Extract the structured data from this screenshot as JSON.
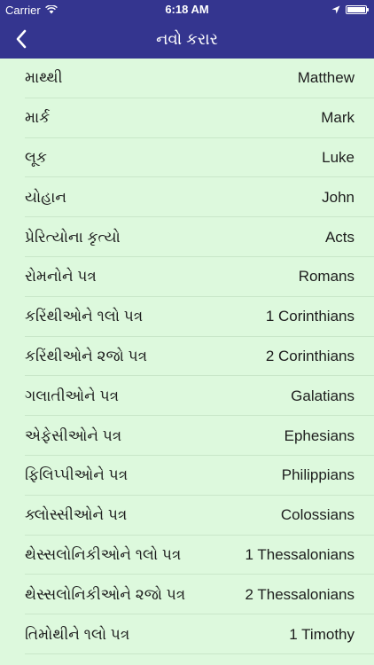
{
  "status_bar": {
    "carrier": "Carrier",
    "time": "6:18 AM"
  },
  "nav": {
    "title": "નવો કરાર",
    "back_icon": "chevron-left-icon"
  },
  "colors": {
    "nav_background": "#34358f",
    "list_background": "#ddf9dd",
    "separator": "#c9e7c9",
    "text": "#1d1d1d"
  },
  "books": [
    {
      "gu": "માથ્થી",
      "en": "Matthew"
    },
    {
      "gu": "માર્ક",
      "en": "Mark"
    },
    {
      "gu": "લૂક",
      "en": "Luke"
    },
    {
      "gu": "યોહાન",
      "en": "John"
    },
    {
      "gu": "પ્રેરિત્યોના કૃત્યો",
      "en": "Acts"
    },
    {
      "gu": "રોમનોને પત્ર",
      "en": "Romans"
    },
    {
      "gu": "કરિંથીઓને ૧લો પત્ર",
      "en": "1 Corinthians"
    },
    {
      "gu": "કરિંથીઓને ૨જો પત્ર",
      "en": "2 Corinthians"
    },
    {
      "gu": "ગલાતીઓને પત્ર",
      "en": "Galatians"
    },
    {
      "gu": "એફેસીઓને પત્ર",
      "en": "Ephesians"
    },
    {
      "gu": "ફિલિપ્પીઓને પત્ર",
      "en": "Philippians"
    },
    {
      "gu": "ક્લોસ્સીઓને પત્ર",
      "en": "Colossians"
    },
    {
      "gu": "થેસ્સલોનિકીઓને ૧લો પત્ર",
      "en": "1 Thessalonians"
    },
    {
      "gu": "થેસ્સલોનિકીઓને ૨જો પત્ર",
      "en": "2 Thessalonians"
    },
    {
      "gu": "તિમોથીને ૧લો પત્ર",
      "en": "1 Timothy"
    }
  ]
}
